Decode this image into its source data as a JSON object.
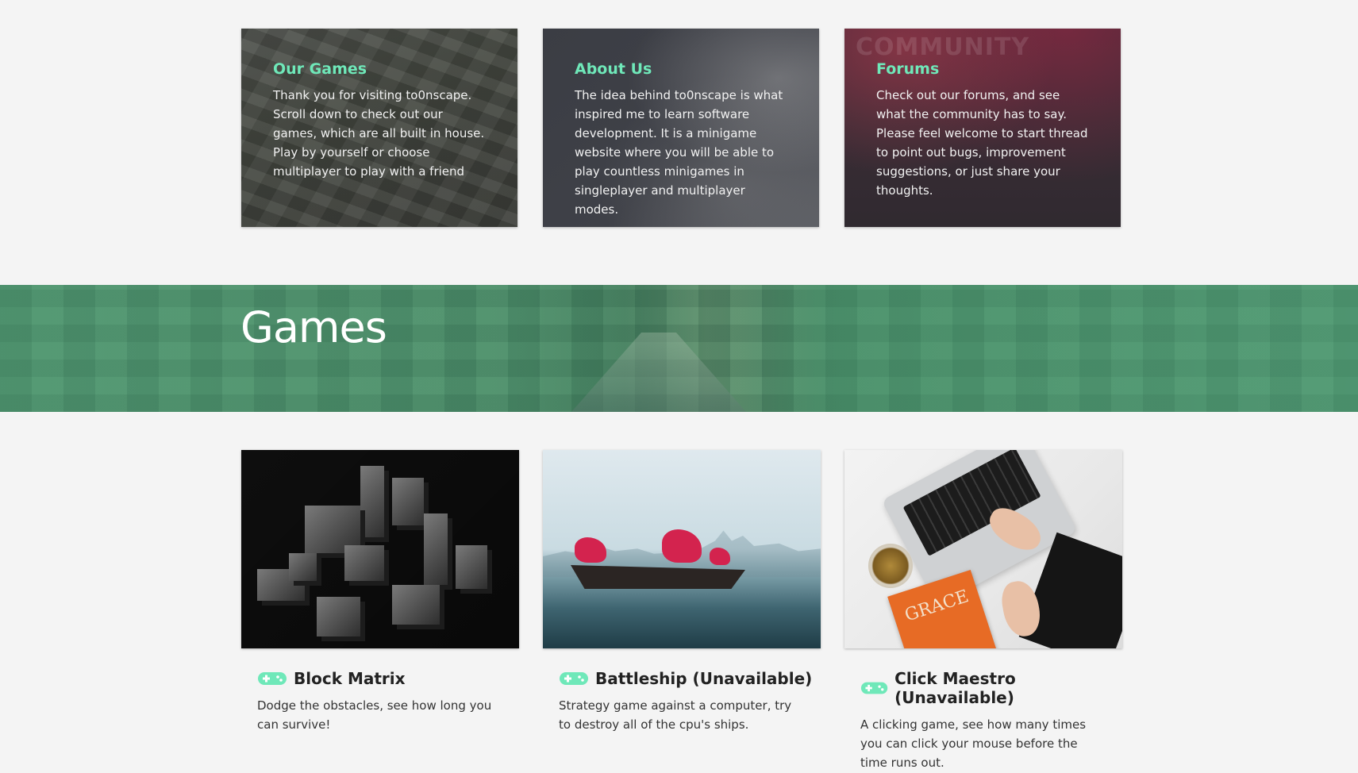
{
  "info_cards": [
    {
      "title": "Our Games",
      "text": "Thank you for visiting to0nscape. Scroll down to check out our games, which are all built in house. Play by yourself or choose multiplayer to play with a friend"
    },
    {
      "title": "About Us",
      "text": "The idea behind to0nscape is what inspired me to learn software development. It is a minigame website where you will be able to play countless minigames in singleplayer and multiplayer modes."
    },
    {
      "title": "Forums",
      "watermark": "COMMUNITY",
      "text": "Check out our forums, and see what the community has to say. Please feel welcome to start thread to point out bugs, improvement suggestions, or just share your thoughts."
    }
  ],
  "games_section": {
    "title": "Games"
  },
  "games": [
    {
      "title": "Block Matrix",
      "description": "Dodge the obstacles, see how long you can survive!",
      "icon": "gamepad-icon"
    },
    {
      "title": "Battleship (Unavailable)",
      "description": "Strategy game against a computer, try to destroy all of the cpu's ships.",
      "icon": "gamepad-icon"
    },
    {
      "title": "Click Maestro (Unavailable)",
      "description": "A clicking game, see how many times you can click your mouse before the time runs out.",
      "icon": "gamepad-icon",
      "image_book_text": "GRACE"
    }
  ],
  "colors": {
    "accent": "#6fe8b9",
    "banner": "#4f9a75",
    "page_bg": "#f4f4f4"
  }
}
